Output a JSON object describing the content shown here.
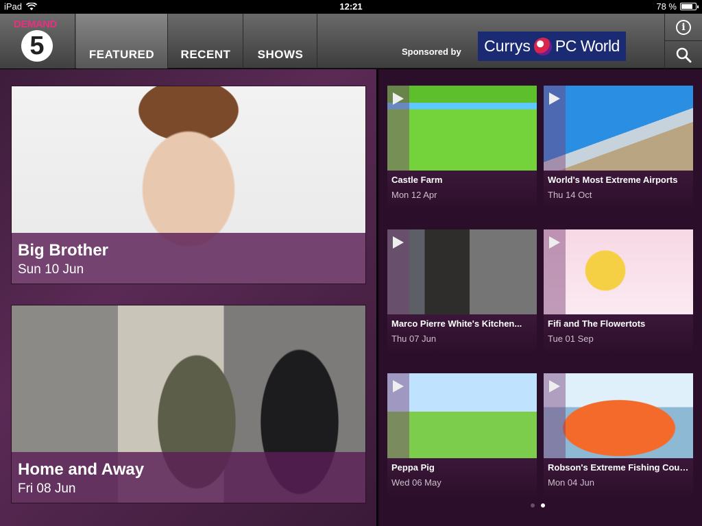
{
  "status": {
    "device": "iPad",
    "time": "12:21",
    "battery": "78 %",
    "battery_level": 0.78
  },
  "header": {
    "logo_text": "DEMAND",
    "logo_number": "5",
    "tabs": [
      {
        "label": "FEATURED",
        "active": true
      },
      {
        "label": "RECENT",
        "active": false
      },
      {
        "label": "SHOWS",
        "active": false
      }
    ],
    "sponsored_label": "Sponsored by",
    "sponsor_left": "Currys",
    "sponsor_right": "PC World",
    "icons": [
      "info-icon",
      "search-icon"
    ]
  },
  "featured": [
    {
      "title": "Big Brother",
      "date": "Sun 10 Jun"
    },
    {
      "title": "Home and Away",
      "date": "Fri 08 Jun"
    }
  ],
  "tiles": [
    {
      "title": "Castle Farm",
      "date": "Mon 12 Apr"
    },
    {
      "title": "World's Most Extreme Airports",
      "date": "Thu 14 Oct"
    },
    {
      "title": "Marco Pierre White's Kitchen...",
      "date": "Thu 07 Jun"
    },
    {
      "title": "Fifi and The Flowertots",
      "date": "Tue 01 Sep"
    },
    {
      "title": "Peppa Pig",
      "date": "Wed 06 May"
    },
    {
      "title": "Robson's Extreme Fishing Coun...",
      "date": "Mon 04 Jun"
    }
  ],
  "pagination": {
    "pages": 2,
    "current": 2
  },
  "colors": {
    "accent_pink": "#e8307f",
    "panel_purple": "#5a2a55",
    "sponsor_blue": "#1b2b73"
  }
}
